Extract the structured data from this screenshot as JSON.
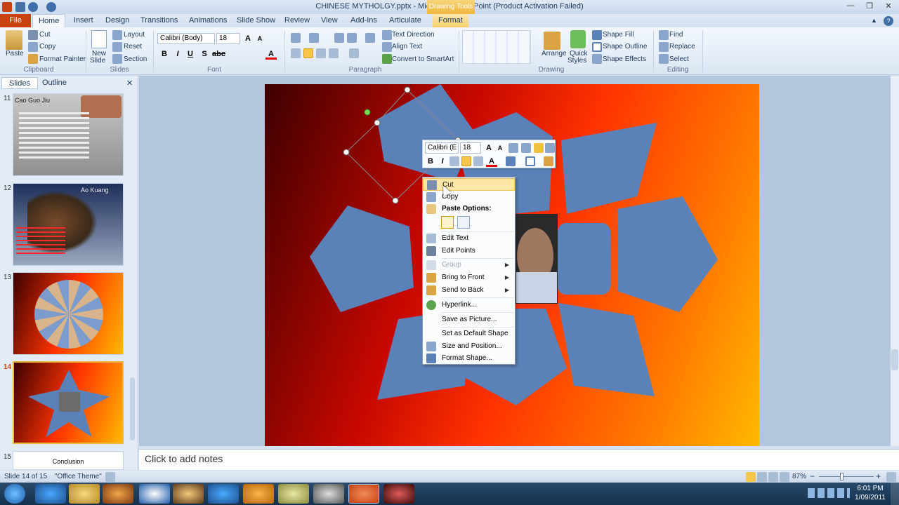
{
  "window": {
    "title": "CHINESE MYTHOLGY.pptx - Microsoft PowerPoint (Product Activation Failed)",
    "context_tab": "Drawing Tools"
  },
  "tabs": [
    "Home",
    "Insert",
    "Design",
    "Transitions",
    "Animations",
    "Slide Show",
    "Review",
    "View",
    "Add-Ins",
    "Articulate",
    "Format"
  ],
  "file_tab": "File",
  "ribbon": {
    "clipboard": {
      "label": "Clipboard",
      "paste": "Paste",
      "cut": "Cut",
      "copy": "Copy",
      "format_painter": "Format Painter"
    },
    "slides": {
      "label": "Slides",
      "new_slide": "New",
      "new_slide2": "Slide",
      "layout": "Layout",
      "reset": "Reset",
      "section": "Section"
    },
    "font": {
      "label": "Font",
      "font_name": "Calibri (Body)",
      "font_size": "18"
    },
    "paragraph": {
      "label": "Paragraph",
      "text_direction": "Text Direction",
      "align_text": "Align Text",
      "smartart": "Convert to SmartArt"
    },
    "drawing": {
      "label": "Drawing",
      "arrange": "Arrange",
      "quick": "Quick",
      "styles": "Styles",
      "shape_fill": "Shape Fill",
      "shape_outline": "Shape Outline",
      "shape_effects": "Shape Effects"
    },
    "editing": {
      "label": "Editing",
      "find": "Find",
      "replace": "Replace",
      "select": "Select"
    }
  },
  "panel": {
    "tabs": [
      "Slides",
      "Outline"
    ],
    "thumbs": [
      {
        "num": "11",
        "title": "Cao Guo Jiu"
      },
      {
        "num": "12",
        "title": "Ao Kuang"
      },
      {
        "num": "13",
        "title": ""
      },
      {
        "num": "14",
        "title": ""
      },
      {
        "num": "15",
        "title": "Conclusion"
      }
    ]
  },
  "mini_toolbar": {
    "font": "Calibri (E",
    "size": "18"
  },
  "context_menu": {
    "cut": "Cut",
    "copy": "Copy",
    "paste_options": "Paste Options:",
    "edit_text": "Edit Text",
    "edit_points": "Edit Points",
    "group": "Group",
    "bring_front": "Bring to Front",
    "send_back": "Send to Back",
    "hyperlink": "Hyperlink...",
    "save_picture": "Save as Picture...",
    "default_shape": "Set as Default Shape",
    "size_position": "Size and Position...",
    "format_shape": "Format Shape..."
  },
  "notes": {
    "placeholder": "Click to add notes"
  },
  "status": {
    "slide": "Slide 14 of 15",
    "theme": "\"Office Theme\"",
    "zoom": "87%"
  },
  "clock": {
    "time": "6:01 PM",
    "date": "1/09/2011"
  },
  "colors": {
    "accent_file": "#c8410f",
    "shape": "#5b82b8",
    "slide_dark": "#3d0000",
    "slide_light": "#ffb800"
  }
}
